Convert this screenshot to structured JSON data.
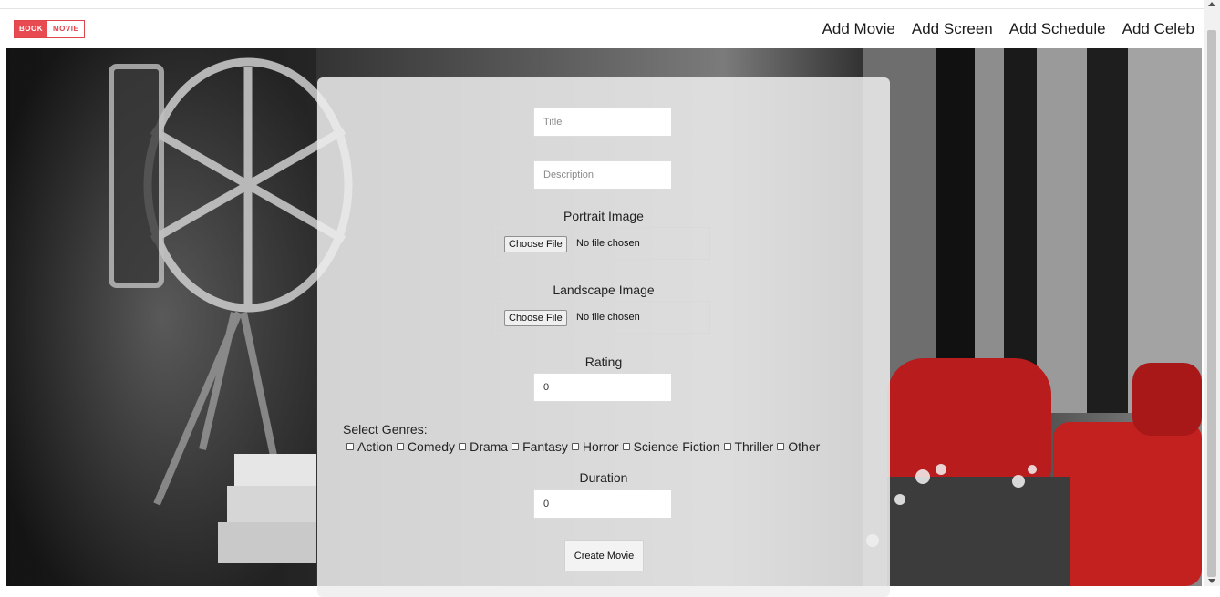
{
  "brand": {
    "part1": "BOOK",
    "part2": "MOVIE"
  },
  "nav": [
    {
      "label": "Add Movie"
    },
    {
      "label": "Add Screen"
    },
    {
      "label": "Add Schedule"
    },
    {
      "label": "Add Celeb"
    }
  ],
  "form": {
    "title_placeholder": "Title",
    "description_placeholder": "Description",
    "portrait_label": "Portrait Image",
    "landscape_label": "Landscape Image",
    "choose_file_label": "Choose File",
    "no_file_text": "No file chosen",
    "rating_label": "Rating",
    "rating_value": "0",
    "genres_label": "Select Genres:",
    "genres": [
      "Action",
      "Comedy",
      "Drama",
      "Fantasy",
      "Horror",
      "Science Fiction",
      "Thriller",
      "Other"
    ],
    "duration_label": "Duration",
    "duration_value": "0",
    "submit_label": "Create Movie"
  },
  "colors": {
    "brand_red": "#e84a51",
    "seat_red": "#b81c1c"
  },
  "icons": [
    "scroll-up-icon",
    "scroll-down-icon",
    "checkbox-icon"
  ]
}
